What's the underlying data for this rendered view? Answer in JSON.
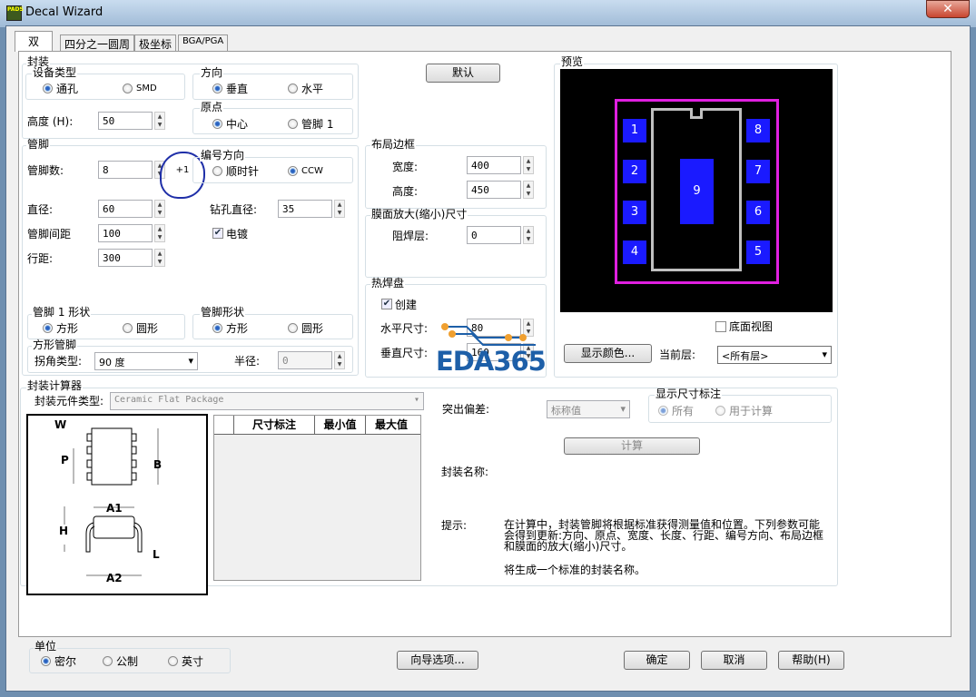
{
  "window": {
    "title": "Decal Wizard",
    "app_icon": "PADS",
    "close": "✕"
  },
  "tabs": [
    "双",
    "四分之一圆周",
    "极坐标",
    "BGA/PGA"
  ],
  "package": {
    "label": "封装",
    "device_type": {
      "label": "设备类型",
      "options": [
        "通孔",
        "SMD"
      ],
      "selected": 0
    },
    "direction": {
      "label": "方向",
      "options": [
        "垂直",
        "水平"
      ],
      "selected": 0
    },
    "origin": {
      "label": "原点",
      "options": [
        "中心",
        "管脚 1"
      ],
      "selected": 0
    },
    "height_label": "高度 (H):",
    "height": "50"
  },
  "pins": {
    "label": "管脚",
    "count_label": "管脚数:",
    "count": "8",
    "annotation": "+1",
    "numbering": {
      "label": "编号方向",
      "options": [
        "顺时针",
        "CCW"
      ],
      "selected": 1
    },
    "diameter_label": "直径:",
    "diameter": "60",
    "drill_label": "钻孔直径:",
    "drill": "35",
    "pitch_label": "管脚间距",
    "pitch": "100",
    "plated_label": "电镀",
    "plated": true,
    "row_label": "行距:",
    "row": "300",
    "pin1_shape": {
      "label": "管脚 1 形状",
      "options": [
        "方形",
        "圆形"
      ],
      "selected": 0
    },
    "pin_shape": {
      "label": "管脚形状",
      "options": [
        "方形",
        "圆形"
      ],
      "selected": 0
    },
    "square": {
      "label": "方形管脚",
      "corner_label": "拐角类型:",
      "corner": "90 度",
      "radius_label": "半径:",
      "radius": "0"
    }
  },
  "layout_border": {
    "label": "布局边框",
    "width_label": "宽度:",
    "width": "400",
    "height_label": "高度:",
    "height": "450"
  },
  "mask": {
    "label": "膜面放大(缩小)尺寸",
    "solder_label": "阻焊层:",
    "solder": "0"
  },
  "thermal": {
    "label": "热焊盘",
    "create_label": "创建",
    "create": true,
    "h_label": "水平尺寸:",
    "h": "80",
    "v_label": "垂直尺寸:",
    "v": "160",
    "watermark": "EDA365"
  },
  "preview": {
    "label": "预览",
    "pads": [
      "1",
      "2",
      "3",
      "4",
      "8",
      "7",
      "6",
      "5",
      "9"
    ],
    "bottom_view": "底面视图",
    "color_btn": "显示颜色...",
    "layer_label": "当前层:",
    "layer": "<所有层>",
    "colors": {
      "pad": "#1a1aff",
      "outline": "#e020e0",
      "body": "#c0c0c0"
    }
  },
  "calculator": {
    "label": "封装计算器",
    "type_label": "封装元件类型:",
    "type": "Ceramic Flat Package",
    "diagram_labels": [
      "W",
      "P",
      "B",
      "A1",
      "H",
      "L",
      "A2"
    ],
    "columns": [
      "",
      "尺寸标注",
      "最小值",
      "最大值"
    ],
    "tolerance_label": "突出偏差:",
    "tolerance": "标称值",
    "show_dims": {
      "label": "显示尺寸标注",
      "options": [
        "所有",
        "用于计算"
      ],
      "selected": 0
    },
    "calc_btn": "计算",
    "name_label": "封装名称:",
    "hint_label": "提示:",
    "hint": "在计算中，封装管脚将根据标准获得测量值和位置。下列参数可能会得到更新:方向、原点、宽度、长度、行距、编号方向、布局边框和膜面的放大(缩小)尺寸。",
    "hint2": "将生成一个标准的封装名称。"
  },
  "units": {
    "label": "单位",
    "options": [
      "密尔",
      "公制",
      "英寸"
    ],
    "selected": 0
  },
  "buttons": {
    "wizard": "向导选项...",
    "ok": "确定",
    "cancel": "取消",
    "help": "帮助(H)"
  }
}
